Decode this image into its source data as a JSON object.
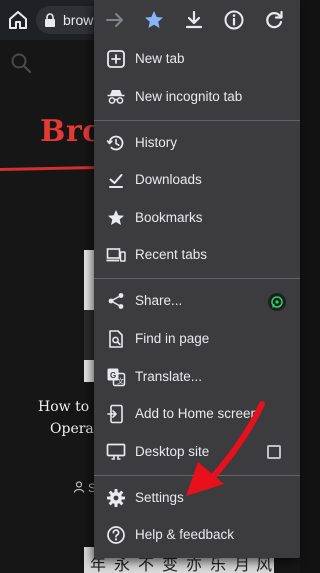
{
  "browser": {
    "url_text": "brows"
  },
  "background_page": {
    "logo_text": "Bro",
    "article_title_line1": "How to S",
    "article_title_line2": "Opera",
    "author_initial": "S",
    "strip_glyphs": [
      "年",
      "永",
      "不",
      "变",
      "亦",
      "乐",
      "月",
      "风"
    ]
  },
  "menu": {
    "items": [
      {
        "label": "New tab",
        "icon": "plus-box-icon"
      },
      {
        "label": "New incognito tab",
        "icon": "incognito-icon"
      },
      {
        "label": "History",
        "icon": "history-icon"
      },
      {
        "label": "Downloads",
        "icon": "download-done-icon"
      },
      {
        "label": "Bookmarks",
        "icon": "star-icon"
      },
      {
        "label": "Recent tabs",
        "icon": "devices-icon"
      },
      {
        "label": "Share...",
        "icon": "share-icon"
      },
      {
        "label": "Find in page",
        "icon": "find-in-page-icon"
      },
      {
        "label": "Translate...",
        "icon": "translate-icon"
      },
      {
        "label": "Add to Home screen",
        "icon": "add-to-home-icon"
      },
      {
        "label": "Desktop site",
        "icon": "desktop-icon"
      },
      {
        "label": "Settings",
        "icon": "gear-icon"
      },
      {
        "label": "Help & feedback",
        "icon": "help-icon"
      }
    ],
    "desktop_site_checked": false,
    "bookmark_starred": true
  },
  "colors": {
    "accent_blue": "#8ab4f8",
    "annotation_red": "#e8101a",
    "logo_red": "#e53935",
    "menu_bg": "#3c3c3e"
  }
}
